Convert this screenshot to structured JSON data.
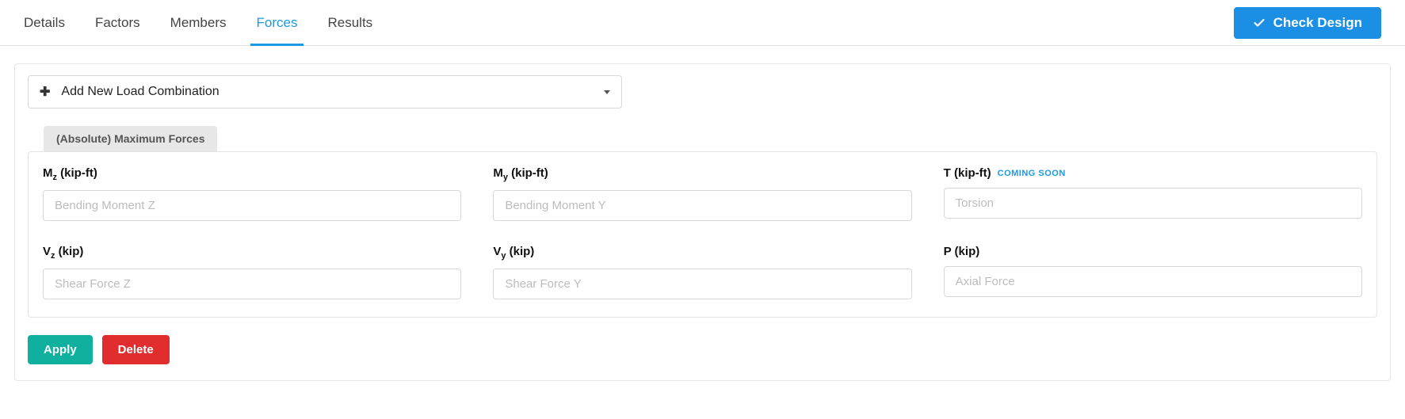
{
  "tabs": {
    "details": "Details",
    "factors": "Factors",
    "members": "Members",
    "forces": "Forces",
    "results": "Results"
  },
  "check_design_label": "Check Design",
  "combo_dropdown_label": "Add New Load Combination",
  "subtab_label": "(Absolute) Maximum Forces",
  "fields": {
    "mz": {
      "label_prefix": "M",
      "label_sub": "z",
      "label_unit": " (kip-ft)",
      "placeholder": "Bending Moment Z"
    },
    "my": {
      "label_prefix": "M",
      "label_sub": "y",
      "label_unit": " (kip-ft)",
      "placeholder": "Bending Moment Y"
    },
    "t": {
      "label_full": "T (kip-ft)",
      "placeholder": "Torsion",
      "badge": "COMING SOON"
    },
    "vz": {
      "label_prefix": "V",
      "label_sub": "z",
      "label_unit": " (kip)",
      "placeholder": "Shear Force Z"
    },
    "vy": {
      "label_prefix": "V",
      "label_sub": "y",
      "label_unit": " (kip)",
      "placeholder": "Shear Force Y"
    },
    "p": {
      "label_full": "P (kip)",
      "placeholder": "Axial Force"
    }
  },
  "buttons": {
    "apply": "Apply",
    "delete": "Delete"
  }
}
